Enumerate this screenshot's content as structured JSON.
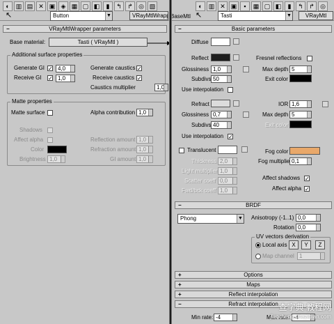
{
  "left": {
    "toolbar": {
      "material_name": "Button",
      "material_type": "VRayMtlWrapp"
    },
    "rollout_title": "VRayMtlWrapper parameters",
    "base_material_label": "Base material:",
    "base_material_value": "Tasti  ( VRayMtl )",
    "additional": {
      "title": "Additional surface properties",
      "generate_gi": "Generate GI",
      "generate_gi_value": "4,0",
      "receive_gi": "Receive GI",
      "receive_gi_value": "1,0",
      "generate_caustics": "Generate caustics",
      "receive_caustics": "Receive caustics",
      "caustics_multiplier": "Caustics multiplier",
      "caustics_multiplier_value": "1,0"
    },
    "matte": {
      "title": "Matte properties",
      "matte_surface": "Matte surface",
      "alpha_contribution": "Alpha contribution",
      "alpha_contribution_value": "1,0",
      "shadows": "Shadows",
      "affect_alpha": "Affect alpha",
      "color": "Color",
      "brightness": "Brightness",
      "brightness_value": "1,0",
      "reflection_amount": "Reflection amount",
      "reflection_amount_value": "1,0",
      "refraction_amount": "Refraction amount",
      "refraction_amount_value": "1,0",
      "gi_amount": "GI amount",
      "gi_amount_value": "1,0"
    }
  },
  "right": {
    "toolbar": {
      "left_label": "BaseMtl",
      "material_name": "Tasti",
      "material_type": "VRayMtl"
    },
    "basic_title": "Basic parameters",
    "diffuse": "Diffuse",
    "reflect": "Reflect",
    "glossiness": "Glossiness",
    "refl_glossiness_value": "1,0",
    "subdivs": "Subdivs",
    "refl_subdivs_value": "50",
    "use_interpolation": "Use interpolation",
    "fresnel": "Fresnel reflections",
    "max_depth": "Max depth",
    "refl_max_depth_value": "5",
    "exit_color": "Exit color",
    "refract": "Refract",
    "ior": "IOR",
    "ior_value": "1,6",
    "refr_glossiness_value": "0,7",
    "refr_subdivs_value": "40",
    "refr_max_depth_value": "5",
    "translucent": "Translucent",
    "thickness": "Thickness",
    "thickness_value": "2,0",
    "light_multiplier": "Light multiplier",
    "light_multiplier_value": "1,0",
    "scatter_coeff": "Scatter coeff",
    "scatter_coeff_value": "0,0",
    "fwd_bck_coeff": "Fwd/bck coeff",
    "fwd_bck_coeff_value": "1,0",
    "fog_color": "Fog color",
    "fog_multiplier": "Fog multiplier",
    "fog_multiplier_value": "0,1",
    "affect_shadows": "Affect shadows",
    "affect_alpha": "Affect alpha",
    "brdf_title": "BRDF",
    "brdf_type": "Phong",
    "anisotropy": "Anisotropy (-1..1)",
    "anisotropy_value": "0,0",
    "rotation": "Rotation",
    "rotation_value": "0,0",
    "uv_title": "UV vectors derivation",
    "local_axis": "Local axis",
    "axis_x": "X",
    "axis_y": "Y",
    "axis_z": "Z",
    "map_channel": "Map channel",
    "map_channel_value": "1",
    "options_title": "Options",
    "maps_title": "Maps",
    "reflect_interp_title": "Reflect interpolation",
    "refract_interp_title": "Refract interpolation",
    "min_rate": "Min rate:",
    "min_rate_value": "-4",
    "max_rate": "Max rate:",
    "max_rate_value": "-4"
  },
  "watermark": {
    "line1": "查字典 教程网",
    "line2": "jiaocheng.chazidian.com"
  },
  "colors": {
    "diffuse": "#ffffff",
    "reflect": "#1e1e1e",
    "exit": "#000000",
    "refract": "#dcdcdc",
    "refr_exit": "#000000",
    "translucent": "#ffffff",
    "fog": "#e9a86a",
    "matte_color": "#000000"
  }
}
